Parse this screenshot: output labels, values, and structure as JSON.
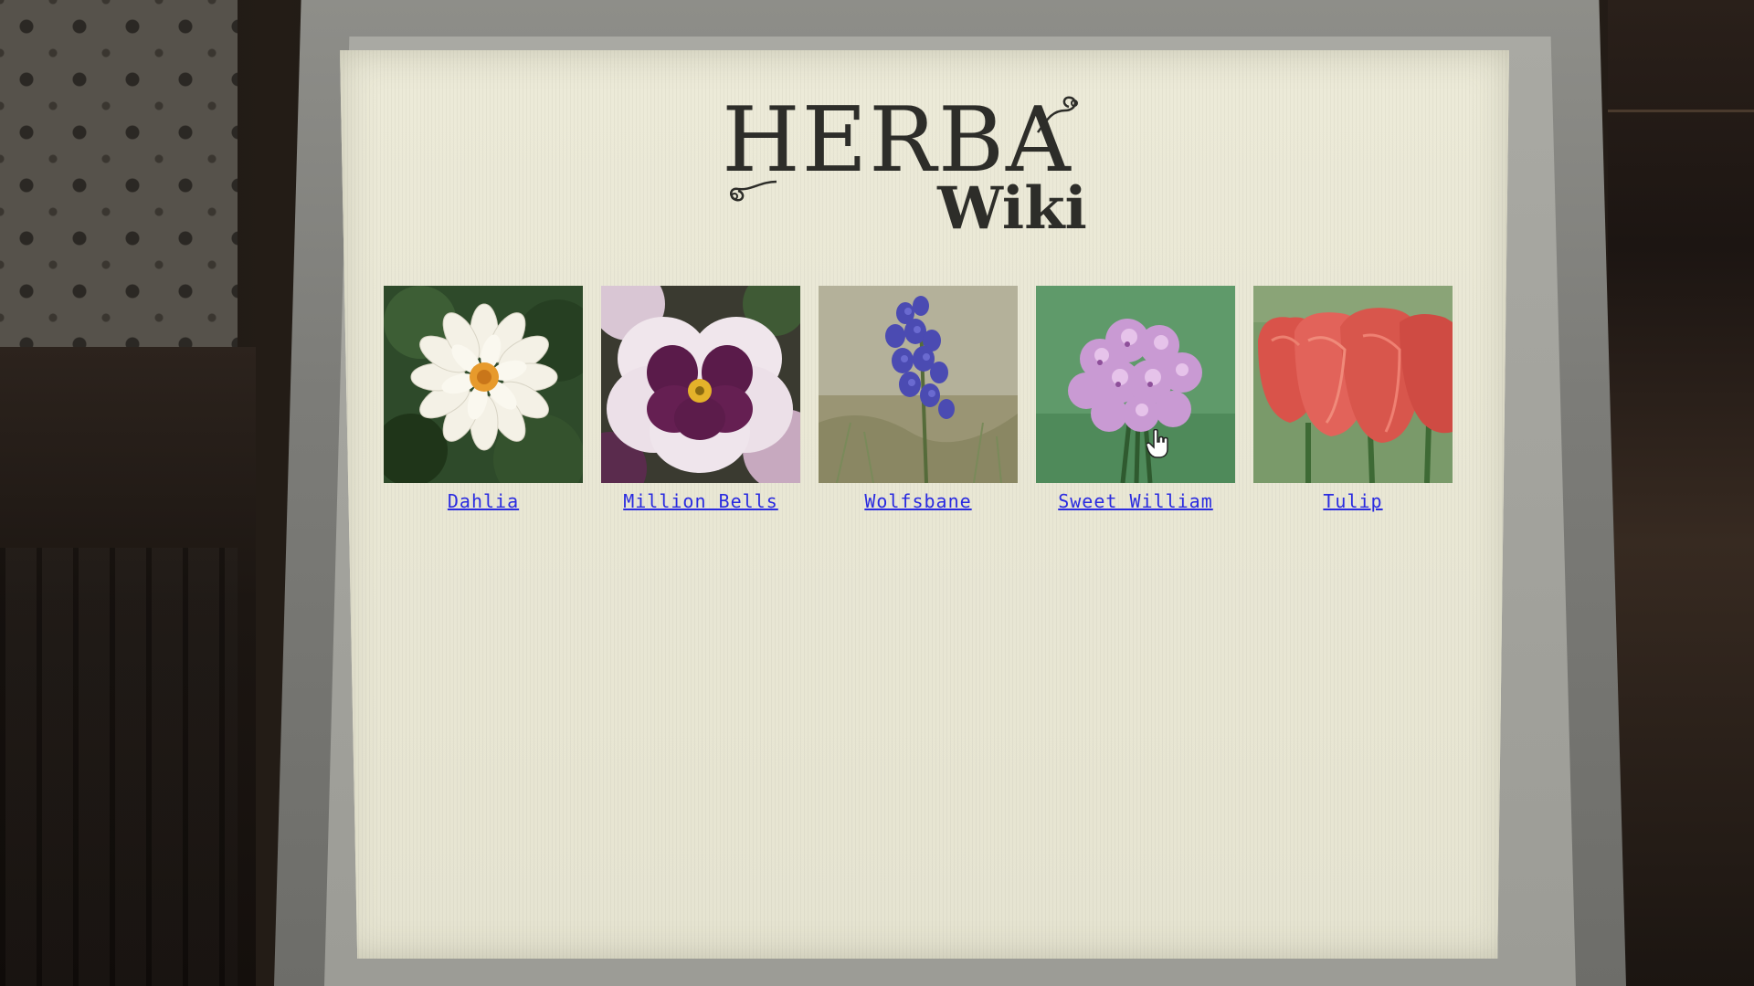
{
  "site": {
    "logo_title": "HERBA",
    "logo_subtitle": "Wiki"
  },
  "flowers": [
    {
      "name": "Dahlia",
      "image_icon": "white-dahlia-photo"
    },
    {
      "name": "Million Bells",
      "image_icon": "purple-white-flower-photo"
    },
    {
      "name": "Wolfsbane",
      "image_icon": "blue-wolfsbane-photo"
    },
    {
      "name": "Sweet William",
      "image_icon": "pink-sweet-william-photo"
    },
    {
      "name": "Tulip",
      "image_icon": "red-tulip-photo"
    }
  ],
  "colors": {
    "link": "#2a2be0",
    "page_background": "#e8e6d4",
    "logo_text": "#2d2d29"
  }
}
